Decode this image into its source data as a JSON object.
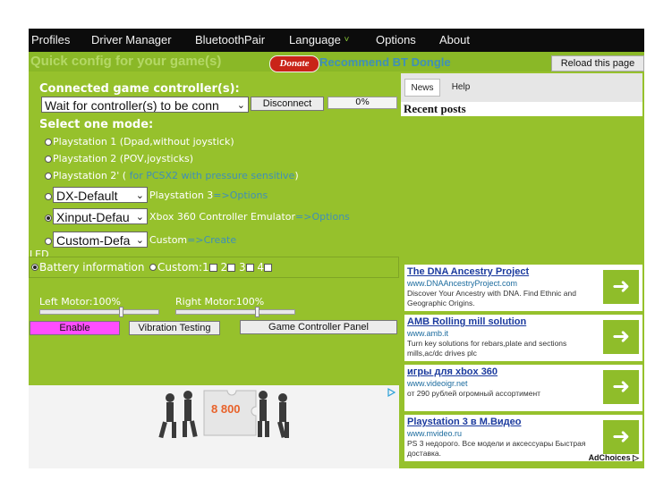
{
  "menu": {
    "profiles": "Profiles",
    "driver_manager": "Driver Manager",
    "bluetooth_pair": "BluetoothPair",
    "language": "Language",
    "language_chevron": "˅",
    "options": "Options",
    "about": "About"
  },
  "header": {
    "quick_config": "Quick config for your game(s)",
    "donate": "Donate",
    "recommend": "Recommend BT Dongle",
    "reload": "Reload this page"
  },
  "connection": {
    "heading": "Connected game controller(s):",
    "controller_select": "Wait for controller(s) to be conn",
    "disconnect": "Disconnect",
    "progress_text": "0%",
    "progress": 0
  },
  "mode": {
    "heading": "Select one mode:",
    "options": [
      {
        "label": "Playstation 1 (Dpad,without joystick)",
        "link": ""
      },
      {
        "label": "Playstation 2 (POV,joysticks)",
        "link": ""
      },
      {
        "label": "Playstation 2' (",
        "link": " for PCSX2 with pressure sensitive",
        "suffix": ")"
      },
      {
        "select": "DX-Default",
        "label": "Playstation 3",
        "link": "=>Options"
      },
      {
        "select": "Xinput-Defau",
        "label": "Xbox 360 Controller Emulator",
        "link": "=>Options"
      },
      {
        "select": "Custom-Defa",
        "label": "Custom",
        "link": "=>Create"
      }
    ],
    "selected_index": 4
  },
  "led": {
    "legend": "LED",
    "battery": "Battery information",
    "custom": "Custom:",
    "checks": [
      "1",
      "2",
      "3",
      "4"
    ]
  },
  "motors": {
    "left_label": "Left Motor:100%",
    "right_label": "Right Motor:100%",
    "left_level": 100,
    "right_level": 100
  },
  "buttons": {
    "enable": "Enable",
    "vibration": "Vibration Testing",
    "panel": "Game Controller Panel"
  },
  "left_ad": {
    "phone_text": "8 800"
  },
  "right_panel": {
    "tab_news": "News",
    "tab_help": "Help",
    "recent_posts": "Recent posts"
  },
  "ads": [
    {
      "title": "The DNA Ancestry Project",
      "url": "www.DNAAncestryProject.com",
      "desc": "Discover Your Ancestry with DNA. Find Ethnic and Geographic Origins."
    },
    {
      "title": "AMB Rolling mill solution",
      "url": "www.amb.it",
      "desc": "Turn key solutions for rebars,plate and sections mills,ac/dc drives plc"
    },
    {
      "title": "игры для xbox 360",
      "url": "www.videoigr.net",
      "desc": "от 290 рублей огромный ассортимент"
    },
    {
      "title": "Playstation 3 в М.Видео",
      "url": "www.mvideo.ru",
      "desc": "PS 3 недорого. Все модели и аксессуары Быстрая доставка."
    }
  ],
  "adchoices": "AdChoices ▷",
  "colors": {
    "app_bg": "#96c12c",
    "menubar": "#0c0c0c",
    "link": "#3f8fb8",
    "enable": "#ff4dff",
    "donate": "#c92418"
  }
}
